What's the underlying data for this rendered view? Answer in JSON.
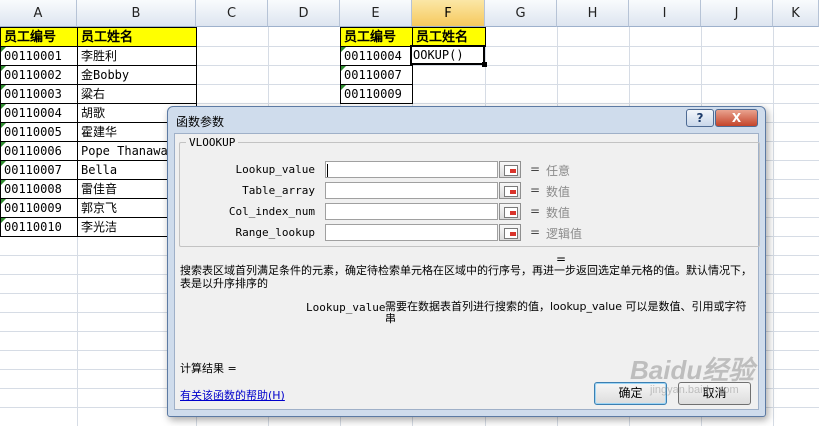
{
  "sheet": {
    "columns": [
      "A",
      "B",
      "C",
      "D",
      "E",
      "F",
      "G",
      "H",
      "I",
      "J",
      "K"
    ],
    "selected_column": "F",
    "table1": {
      "headers": [
        "员工编号",
        "员工姓名"
      ],
      "rows": [
        [
          "00110001",
          "李胜利"
        ],
        [
          "00110002",
          "金Bobby"
        ],
        [
          "00110003",
          "粱右"
        ],
        [
          "00110004",
          "胡歌"
        ],
        [
          "00110005",
          "霍建华"
        ],
        [
          "00110006",
          "Pope Thanawat"
        ],
        [
          "00110007",
          "Bella"
        ],
        [
          "00110008",
          "雷佳音"
        ],
        [
          "00110009",
          "郭京飞"
        ],
        [
          "00110010",
          "李光洁"
        ]
      ]
    },
    "table2": {
      "headers": [
        "员工编号",
        "员工姓名"
      ],
      "ids": [
        "00110004",
        "00110007",
        "00110009"
      ],
      "active_formula": "OOKUP()"
    }
  },
  "dialog": {
    "title": "函数参数",
    "help_button": "?",
    "close_button": "X",
    "function_name": "VLOOKUP",
    "args": [
      {
        "label": "Lookup_value",
        "eq": "=",
        "value": "任意"
      },
      {
        "label": "Table_array",
        "eq": "=",
        "value": "数值"
      },
      {
        "label": "Col_index_num",
        "eq": "=",
        "value": "数值"
      },
      {
        "label": "Range_lookup",
        "eq": "=",
        "value": "逻辑值"
      }
    ],
    "result_eq": "=",
    "description": "搜索表区域首列满足条件的元素，确定待检索单元格在区域中的行序号，再进一步返回选定单元格的值。默认情况下，表是以升序排序的",
    "arg_help_name": "Lookup_value",
    "arg_help_text": "需要在数据表首列进行搜索的值，lookup_value 可以是数值、引用或字符串",
    "calc_result": "计算结果 =",
    "help_link": "有关该函数的帮助(H)",
    "ok": "确定",
    "cancel": "取消"
  },
  "watermark": {
    "logo": "Baidu经验",
    "sub": "jingyan.baidu.com"
  }
}
